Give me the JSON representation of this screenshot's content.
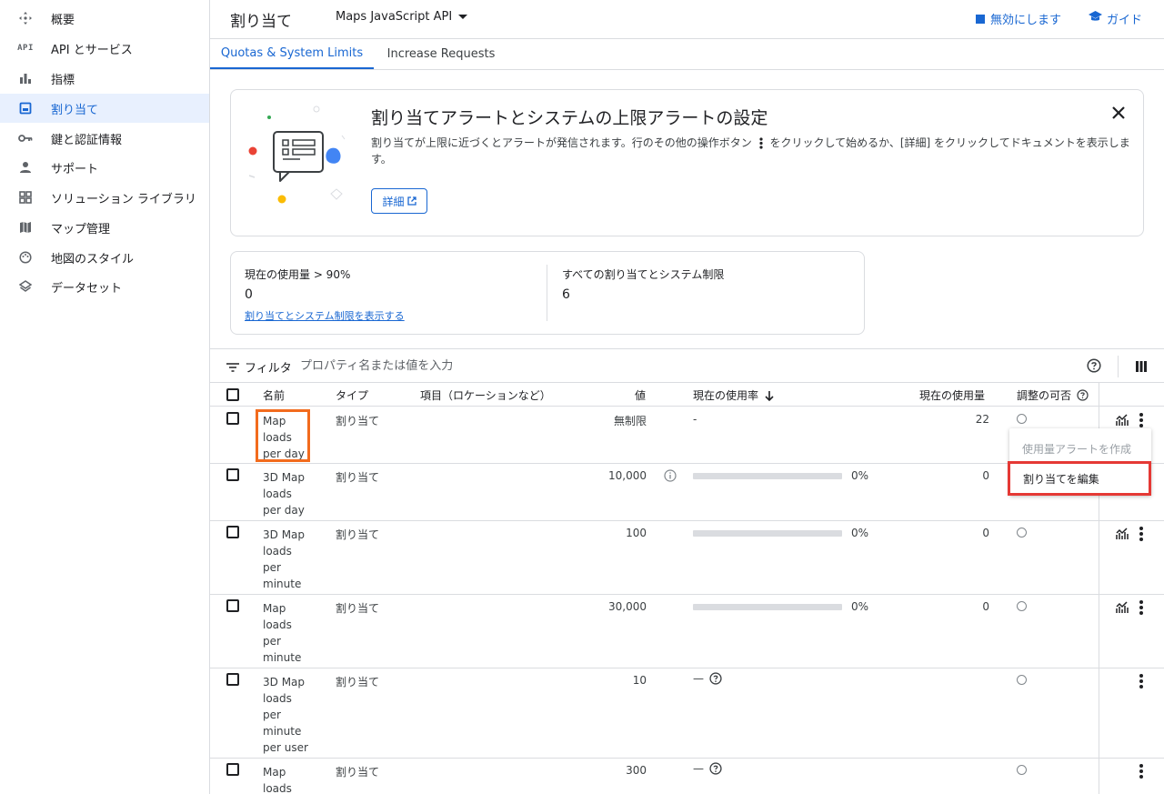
{
  "sidebar": {
    "items": [
      {
        "label": "概要",
        "icon": "overview-icon"
      },
      {
        "label": "API とサービス",
        "icon": "api-icon",
        "icon_text": "API"
      },
      {
        "label": "指標",
        "icon": "bar-chart-icon"
      },
      {
        "label": "割り当て",
        "icon": "quota-icon",
        "active": true
      },
      {
        "label": "鍵と認証情報",
        "icon": "key-icon"
      },
      {
        "label": "サポート",
        "icon": "person-icon"
      },
      {
        "label": "ソリューション ライブラリ",
        "icon": "grid-icon"
      },
      {
        "label": "マップ管理",
        "icon": "map-icon"
      },
      {
        "label": "地図のスタイル",
        "icon": "palette-icon"
      },
      {
        "label": "データセット",
        "icon": "layers-icon"
      }
    ]
  },
  "header": {
    "title": "割り当て",
    "api_select": "Maps JavaScript API",
    "disable_label": "無効にします",
    "guide_label": "ガイド"
  },
  "tabs": [
    {
      "label": "Quotas & System Limits",
      "active": true
    },
    {
      "label": "Increase Requests",
      "active": false
    }
  ],
  "banner": {
    "title": "割り当てアラートとシステムの上限アラートの設定",
    "text_before": "割り当てが上限に近づくとアラートが発信されます。行のその他の操作ボタン",
    "text_after": "をクリックして始めるか、[詳細] をクリックしてドキュメントを表示します。",
    "detail_button": "詳細"
  },
  "summary": {
    "current_usage_label": "現在の使用量 > 90%",
    "current_usage_value": "0",
    "view_link": "割り当てとシステム制限を表示する",
    "all_label": "すべての割り当てとシステム制限",
    "all_value": "6"
  },
  "filter": {
    "label": "フィルタ",
    "placeholder": "プロパティ名または値を入力"
  },
  "table": {
    "headers": {
      "name": "名前",
      "type": "タイプ",
      "dimensions": "項目（ロケーションなど）",
      "value": "値",
      "usage_rate": "現在の使用率",
      "usage": "現在の使用量",
      "adjustable": "調整の可否"
    },
    "rows": [
      {
        "name": "Map loads per day",
        "type": "割り当て",
        "value": "無制限",
        "rate": "-",
        "usage": "22"
      },
      {
        "name": "3D Map loads per day",
        "type": "割り当て",
        "value": "10,000",
        "rate": "0%",
        "rate_fraction": 0,
        "usage": "0"
      },
      {
        "name": "3D Map loads per minute",
        "type": "割り当て",
        "value": "100",
        "rate": "0%",
        "rate_fraction": 0,
        "usage": "0"
      },
      {
        "name": "Map loads per minute",
        "type": "割り当て",
        "value": "30,000",
        "rate": "0%",
        "rate_fraction": 0,
        "usage": "0"
      },
      {
        "name": "3D Map loads per minute per user",
        "type": "割り当て",
        "value": "10",
        "rate": "—",
        "usage": ""
      },
      {
        "name": "Map loads",
        "type": "割り当て",
        "value": "300",
        "rate": "—",
        "usage": ""
      }
    ]
  },
  "menu": {
    "items": [
      {
        "label": "使用量アラートを作成",
        "disabled": true
      },
      {
        "label": "割り当てを編集",
        "disabled": false
      }
    ]
  },
  "colors": {
    "accent": "#1967d2",
    "highlight_orange": "#f26b1d",
    "highlight_red": "#e53935"
  }
}
